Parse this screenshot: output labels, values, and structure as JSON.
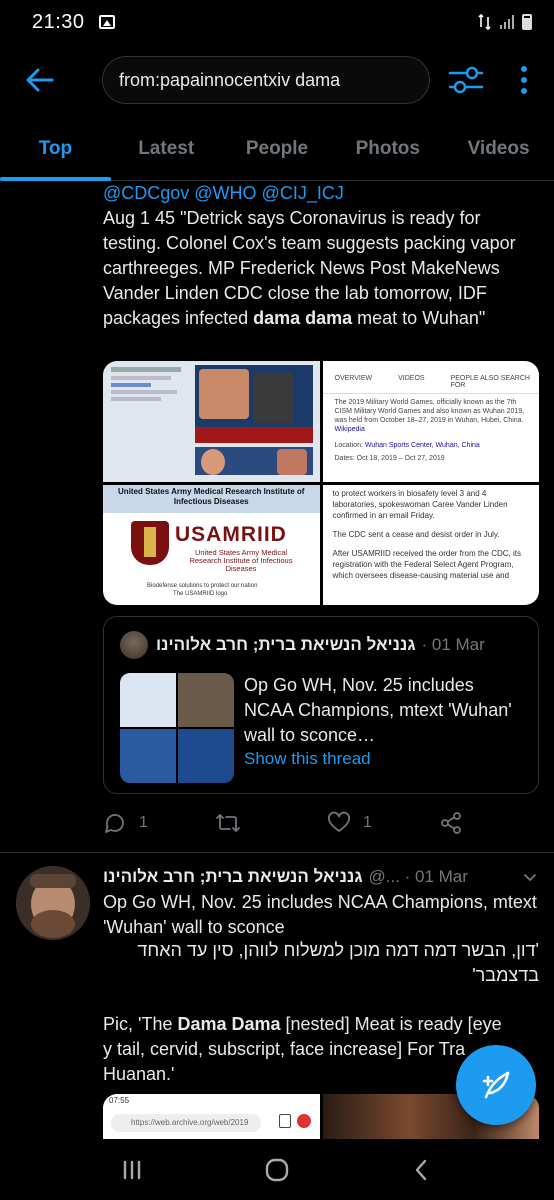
{
  "status_bar": {
    "time": "21:30"
  },
  "header": {
    "search_value": "from:papainnocentxiv dama",
    "back_icon": "arrow-left-icon",
    "filter_icon": "sliders-icon",
    "more_icon": "more-vertical-icon"
  },
  "tabs": [
    {
      "label": "Top",
      "active": true
    },
    {
      "label": "Latest",
      "active": false
    },
    {
      "label": "People",
      "active": false
    },
    {
      "label": "Photos",
      "active": false
    },
    {
      "label": "Videos",
      "active": false
    }
  ],
  "tweet1": {
    "mentions": "@CDCgov @WHO @CIJ_ICJ",
    "text_part1": "Aug 1 45 \"Detrick says Coronavirus is ready for testing. Colonel Cox's team suggests packing vapor carthreeges. MP Frederick News Post MakeNews Vander Linden CDC close the lab tomorrow, IDF packages infected ",
    "text_bold": "dama dama",
    "text_part2": " meat to Wuhan\"",
    "media": {
      "tl_caption": "",
      "tr_tab1": "OVERVIEW",
      "tr_tab2": "VIDEOS",
      "tr_tab3": "PEOPLE ALSO SEARCH FOR",
      "tr_text": "The 2019 Military World Games, officially known as the 7th CISM Military World Games and also known as Wuhan 2019, was held from October 18–27, 2019 in Wuhan, Hubei, China.",
      "tr_wiki": "Wikipedia",
      "tr_location_label": "Location:",
      "tr_location": "Wuhan Sports Center, Wuhan, China",
      "tr_dates": "Dates: Oct 18, 2019 – Oct 27, 2019",
      "bl_title": "United States Army Medical Research Institute of Infectious Diseases",
      "bl_logo": "USAMRIID",
      "bl_sub": "United States Army Medical Research Institute of Infectious Diseases",
      "bl_caption1": "Biodefense solutions to protect our nation",
      "bl_caption2": "The USAMRIID logo",
      "br_p1": "to protect workers in biosafety level 3 and 4 laboratories, spokeswoman Caree Vander Linden confirmed in an email Friday.",
      "br_p2": "The CDC sent a cease and desist order in July.",
      "br_p3": "After USAMRIID received the order from the CDC, its registration with the Federal Select Agent Program, which oversees disease-causing material use and"
    },
    "quote": {
      "name": "גנניאל הנשיאת ברית; חרב אלוהינו",
      "date": "· 01 Mar",
      "text": "Op Go WH, Nov. 25 includes NCAA Champions, mtext 'Wuhan' wall to sconce…",
      "link": "Show this thread"
    },
    "actions": {
      "replies": "1",
      "likes": "1"
    }
  },
  "tweet2": {
    "name": "גנניאל הנשיאת ברית; חרב אלוהינו",
    "handle": "@... · 01 Mar",
    "text1": "Op Go WH, Nov. 25 includes NCAA Champions, mtext 'Wuhan' wall to sconce",
    "text_rtl": "'דון, הבשר דמה דמה מוכן למשלוח לווהן, סין עד האחד בדצמבר'",
    "pic_part1": "Pic, 'The ",
    "pic_bold": "Dama Dama",
    "pic_part2": " [nested] Meat is ready [eye y tail, cervid, subscript, face increase] For Tra Huanan.'",
    "media_time": "07:55",
    "media_url": "https://web.archive.org/web/2019"
  },
  "colors": {
    "accent": "#1d9bf0",
    "background": "#000000",
    "muted": "#71767b"
  }
}
